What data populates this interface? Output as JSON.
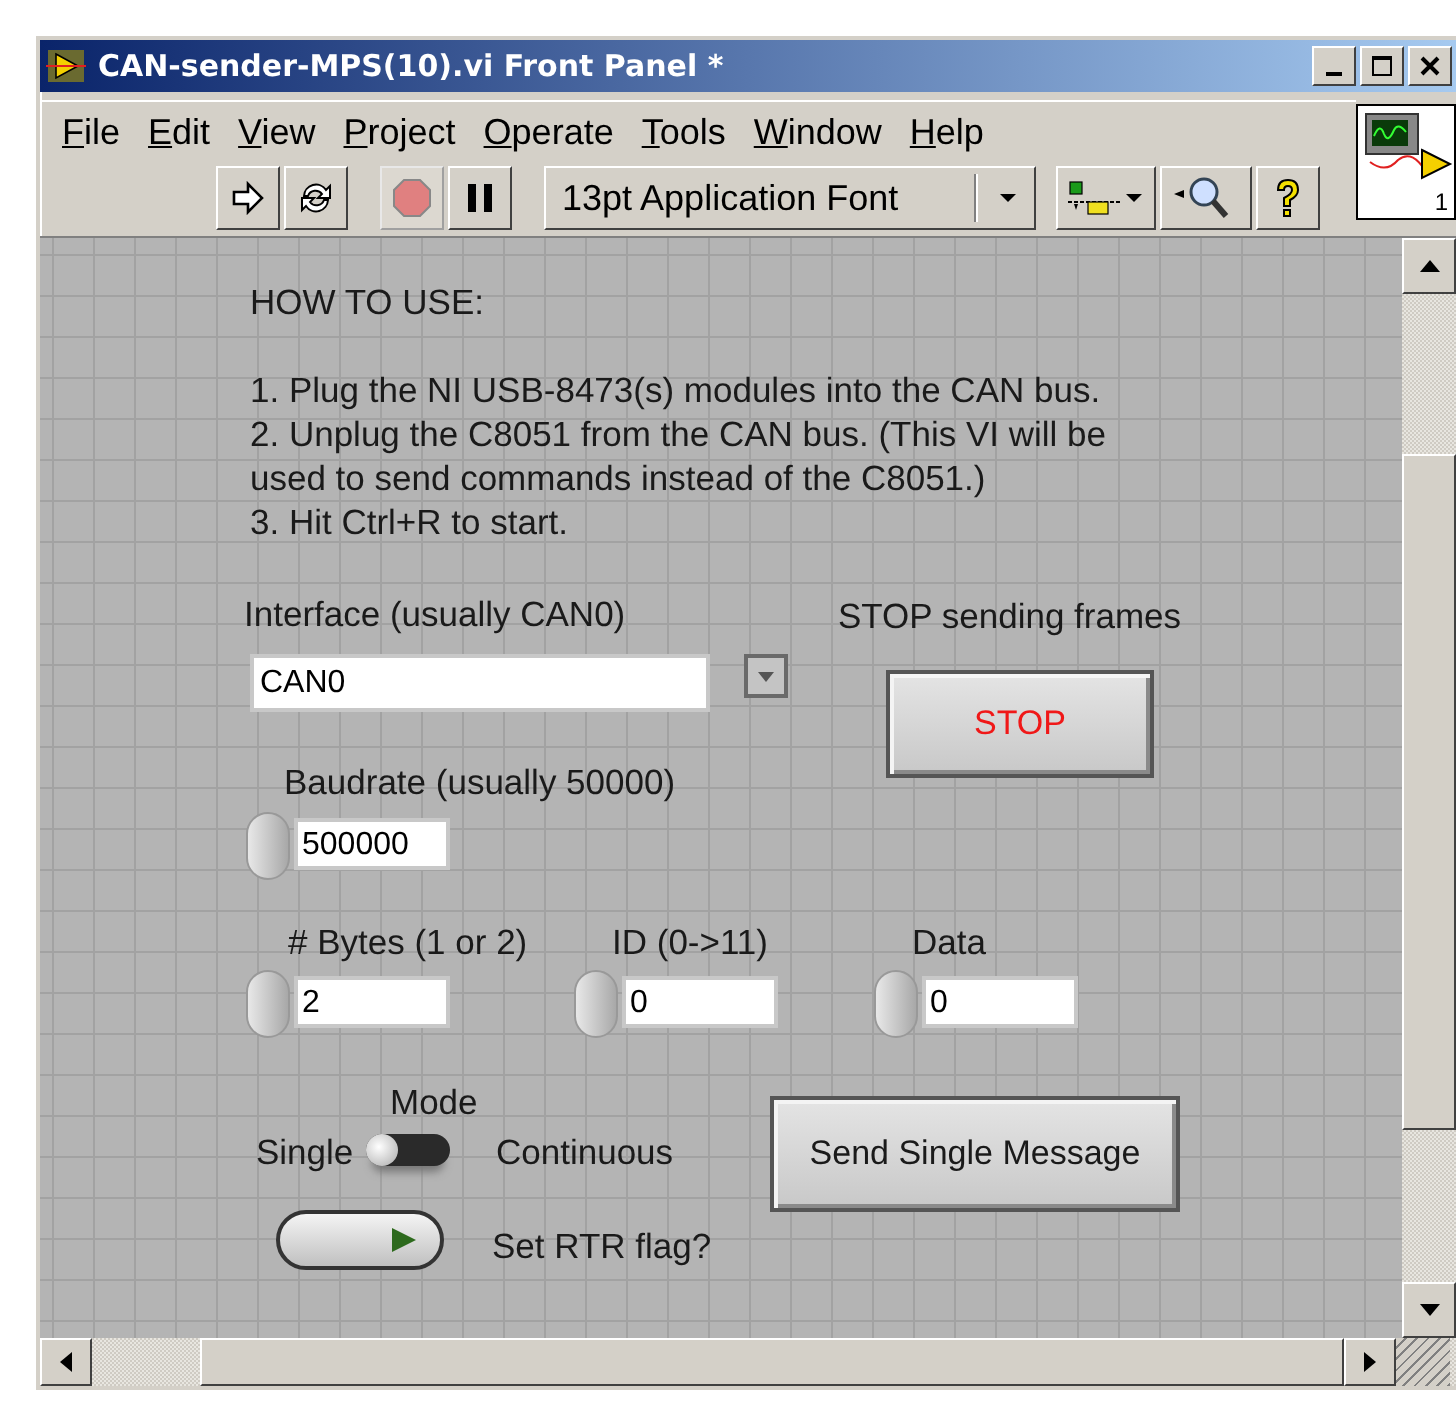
{
  "window": {
    "title": "CAN-sender-MPS(10).vi Front Panel *"
  },
  "menu": [
    "File",
    "Edit",
    "View",
    "Project",
    "Operate",
    "Tools",
    "Window",
    "Help"
  ],
  "toolbar": {
    "abort": {
      "disabled": true
    },
    "font": "13pt Application Font",
    "connector_label": "1"
  },
  "panel": {
    "instructions": [
      "HOW TO USE:",
      "1. Plug the NI USB-8473(s) modules into the CAN bus.",
      "2. Unplug the C8051 from the CAN bus. (This VI will be used to send commands instead of the C8051.)",
      "3. Hit Ctrl+R to start."
    ],
    "interface": {
      "label": "Interface (usually CAN0)",
      "value": "CAN0"
    },
    "stop": {
      "label": "STOP sending frames",
      "button": "STOP"
    },
    "baudrate": {
      "label": "Baudrate (usually 50000)",
      "value": "500000"
    },
    "numerics": [
      {
        "label": "# Bytes (1 or 2)",
        "value": "2"
      },
      {
        "label": "ID (0->11)",
        "value": "0"
      },
      {
        "label": "Data",
        "value": "0"
      }
    ],
    "mode": {
      "label": "Mode",
      "off_text": "Single",
      "on_text": "Continuous",
      "on": false
    },
    "rtr": {
      "label": "Set RTR flag?",
      "on": false
    },
    "send_button": "Send Single Message"
  }
}
